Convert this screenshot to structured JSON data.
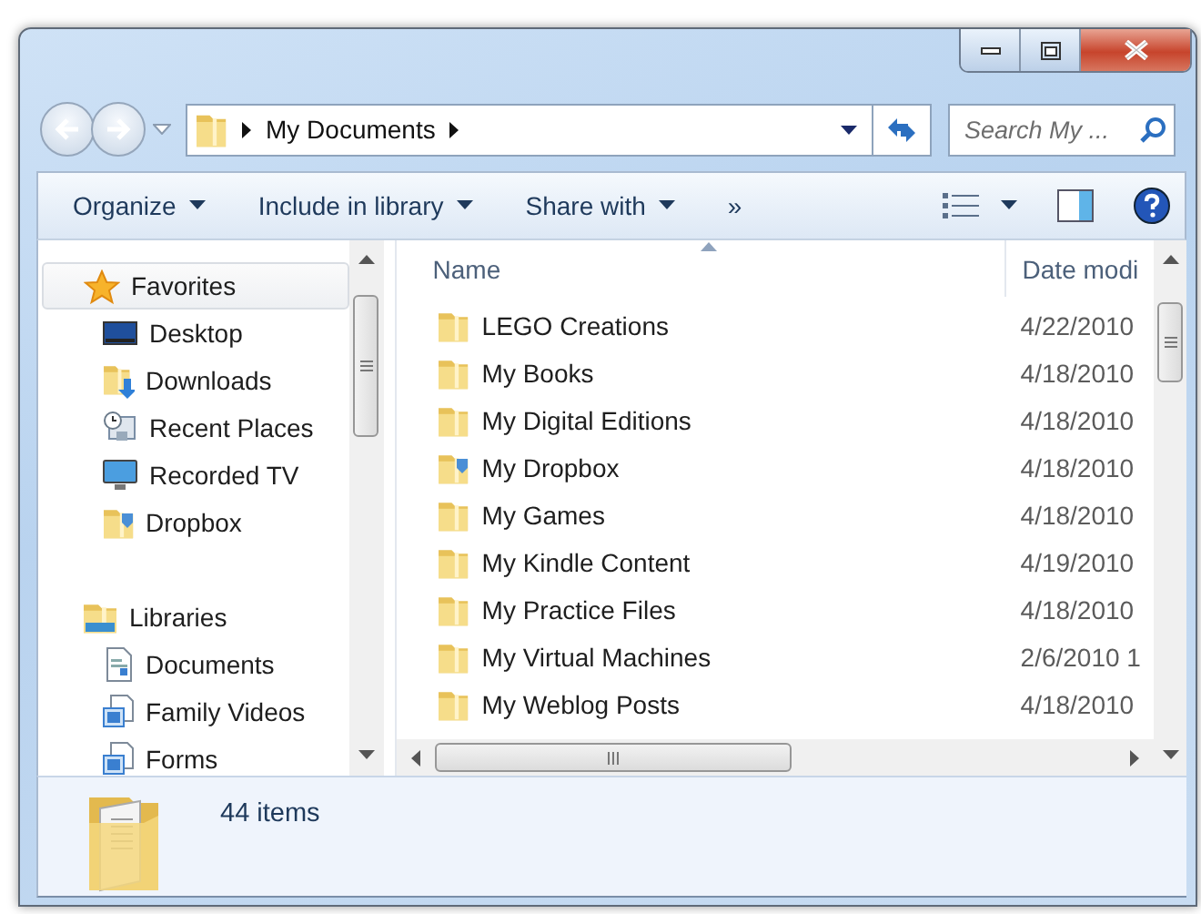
{
  "address_bar": {
    "path": [
      "My Documents"
    ]
  },
  "search": {
    "placeholder": "Search My ..."
  },
  "toolbar": {
    "buttons": [
      {
        "label": "Organize",
        "menu": true
      },
      {
        "label": "Include in library",
        "menu": true
      },
      {
        "label": "Share with",
        "menu": true
      },
      {
        "label": "»",
        "menu": false
      }
    ]
  },
  "navigation": {
    "groups": [
      {
        "label": "Favorites",
        "selected": true,
        "items": [
          {
            "label": "Desktop",
            "selected": false
          },
          {
            "label": "Downloads",
            "selected": false
          },
          {
            "label": "Recent Places",
            "selected": false
          },
          {
            "label": "Recorded TV",
            "selected": false
          },
          {
            "label": "Dropbox",
            "selected": false
          }
        ]
      },
      {
        "label": "Libraries",
        "selected": false,
        "items": [
          {
            "label": "Documents",
            "selected": false
          },
          {
            "label": "Family Videos",
            "selected": false
          },
          {
            "label": "Forms",
            "selected": false
          }
        ]
      }
    ]
  },
  "file_list": {
    "columns": [
      {
        "label": "Name",
        "sorted": true
      },
      {
        "label": "Date modi",
        "sorted": false
      }
    ],
    "rows": [
      {
        "name": "LEGO Creations",
        "date": "4/22/2010"
      },
      {
        "name": "My Books",
        "date": "4/18/2010"
      },
      {
        "name": "My Digital Editions",
        "date": "4/18/2010"
      },
      {
        "name": "My Dropbox",
        "date": "4/18/2010"
      },
      {
        "name": "My Games",
        "date": "4/18/2010"
      },
      {
        "name": "My Kindle Content",
        "date": "4/19/2010"
      },
      {
        "name": "My Practice Files",
        "date": "4/18/2010"
      },
      {
        "name": "My Virtual Machines",
        "date": "2/6/2010 1"
      },
      {
        "name": "My Weblog Posts",
        "date": "4/18/2010"
      }
    ]
  },
  "details": {
    "summary": "44 items"
  }
}
